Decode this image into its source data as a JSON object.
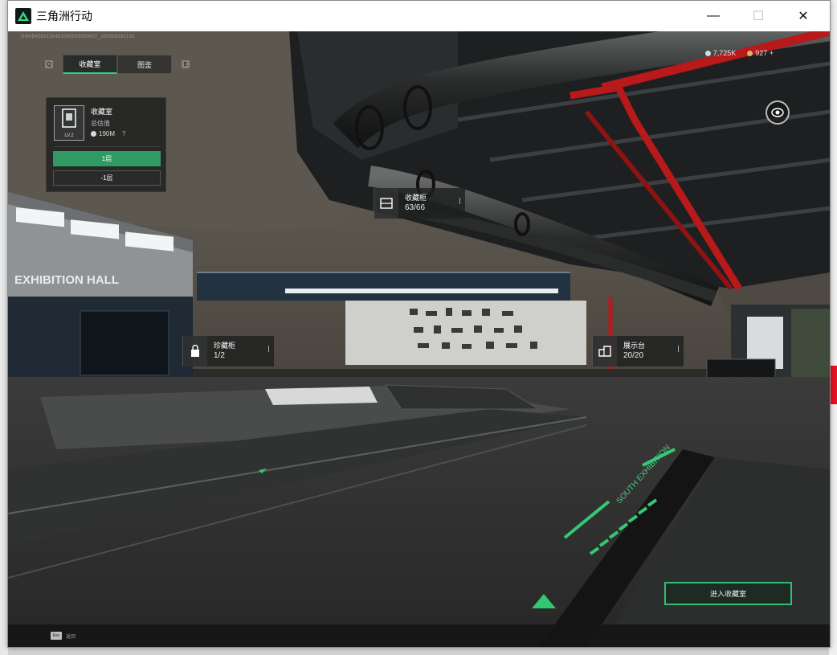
{
  "window": {
    "title": "三角洲行动",
    "controls": {
      "minimize": "—",
      "maximize": "☐",
      "close": "✕"
    }
  },
  "hud": {
    "session_id": "DNHB4392150431000033089607_202008162133",
    "tabs": [
      {
        "label": "收藏室",
        "active": true
      },
      {
        "label": "图鉴",
        "active": false
      }
    ],
    "tab_prev_key": "Q",
    "tab_next_key": "E",
    "currency": [
      {
        "icon": "silver-coin-icon",
        "value": "7,725K"
      },
      {
        "icon": "gold-coin-icon",
        "value": "927 +"
      }
    ]
  },
  "room_card": {
    "name": "收藏室",
    "subtitle": "总估值",
    "value": "190M",
    "help": "?",
    "level": "LV.2",
    "floors": [
      {
        "label": "1层",
        "active": true
      },
      {
        "label": "-1层",
        "active": false
      }
    ]
  },
  "scene": {
    "hall_sign": "EXHIBITION HALL",
    "floor_text": "SOUTH EXHIBITION"
  },
  "tags": [
    {
      "id": "collection-cabinet",
      "title": "收藏柜",
      "count": "63/66"
    },
    {
      "id": "rare-cabinet",
      "title": "珍藏柜",
      "count": "1/2"
    },
    {
      "id": "display-stand",
      "title": "展示台",
      "count": "20/20"
    }
  ],
  "enter_button": {
    "label": "进入收藏室"
  },
  "bottom_bar": {
    "key": "Esc",
    "label": "返回"
  },
  "colors": {
    "accent": "#2fbf70",
    "pipe_red": "#b8191a"
  }
}
